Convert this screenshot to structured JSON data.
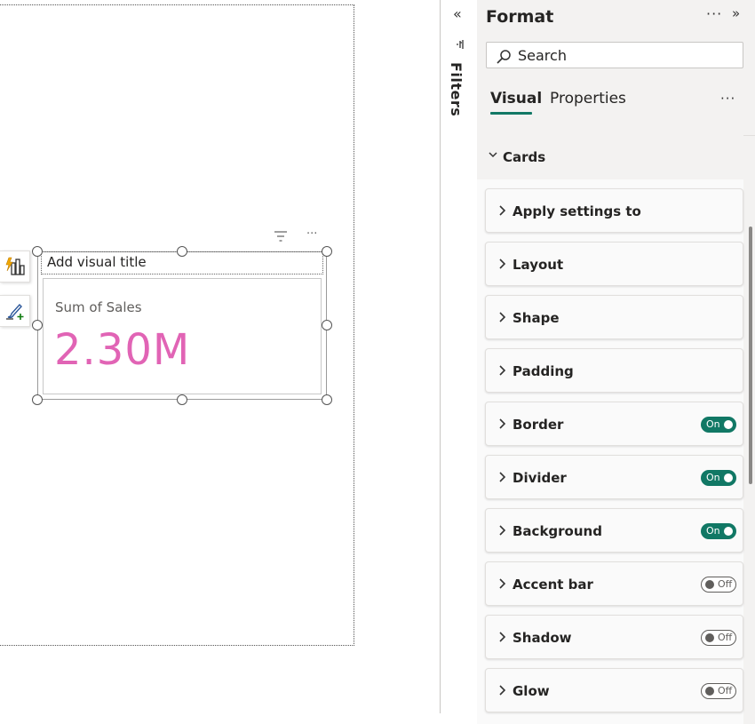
{
  "canvas": {
    "visual": {
      "title_placeholder": "Add visual title",
      "card_label": "Sum of Sales",
      "card_value": "2.30M",
      "value_color": "#e164b5"
    },
    "header_icons": [
      "filter-icon",
      "more-options-icon"
    ],
    "side_tools": [
      "smart-narrative-icon",
      "format-brush-icon"
    ]
  },
  "filters": {
    "collapse_glyph": "«",
    "label": "Filters"
  },
  "format_pane": {
    "title": "Format",
    "more_glyph": "···",
    "expand_glyph": "»",
    "search_placeholder": "Search",
    "tabs": [
      {
        "label": "Visual",
        "active": true
      },
      {
        "label": "Properties",
        "active": false
      }
    ],
    "tabs_more_glyph": "···",
    "section": "Cards",
    "accent_color": "#117865",
    "cards": [
      {
        "label": "Apply settings to"
      },
      {
        "label": "Layout"
      },
      {
        "label": "Shape"
      },
      {
        "label": "Padding"
      },
      {
        "label": "Border",
        "toggle": "On"
      },
      {
        "label": "Divider",
        "toggle": "On"
      },
      {
        "label": "Background",
        "toggle": "On"
      },
      {
        "label": "Accent bar",
        "toggle": "Off"
      },
      {
        "label": "Shadow",
        "toggle": "Off"
      },
      {
        "label": "Glow",
        "toggle": "Off"
      }
    ]
  }
}
